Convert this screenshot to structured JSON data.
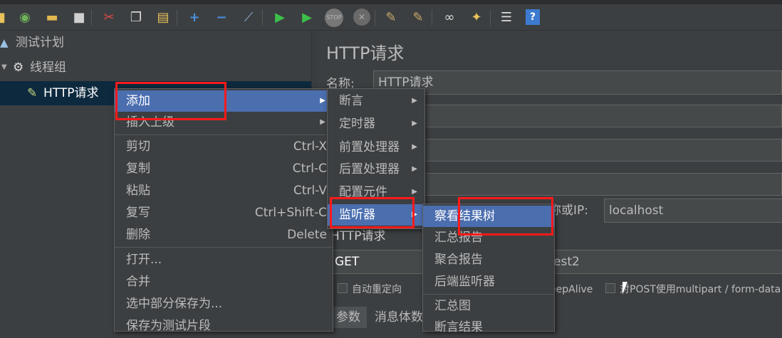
{
  "toolbar": {
    "icons": [
      "new-icon",
      "templates-icon",
      "open-icon",
      "save-icon",
      "cut-icon",
      "copy-icon",
      "paste-icon",
      "expand-icon",
      "collapse-icon",
      "toggle-icon",
      "start-icon",
      "start-no-pause-icon",
      "stop-icon",
      "shutdown-icon",
      "clear-icon",
      "clear-all-icon",
      "search-icon",
      "reset-search-icon",
      "function-helper-icon",
      "help-icon"
    ]
  },
  "tree": {
    "items": [
      {
        "label": "测试计划",
        "icon": "flask-icon"
      },
      {
        "label": "线程组",
        "icon": "gear-icon"
      },
      {
        "label": "HTTP请求",
        "icon": "pipette-icon"
      }
    ]
  },
  "panel": {
    "title": "HTTP请求",
    "name_label": "名称:",
    "name_value": "HTTP请求",
    "server_label": "称或IP:",
    "server_value": "localhost",
    "request_label": "HTTP请求",
    "method_value": "GET",
    "path_fragment": "est2",
    "checkbox_redirect": "自动重定向",
    "checkbox_keepalive": "eepAlive",
    "checkbox_multipart": "对POST使用multipart / form-data",
    "tab_params": "参数",
    "tab_body": "消息体数"
  },
  "menu_main": {
    "items": [
      {
        "label": "添加",
        "shortcut": "",
        "submenu": true
      },
      {
        "label": "插入上级",
        "shortcut": "",
        "submenu": true
      },
      {
        "label": "剪切",
        "shortcut": "Ctrl-X"
      },
      {
        "label": "复制",
        "shortcut": "Ctrl-C"
      },
      {
        "label": "粘贴",
        "shortcut": "Ctrl-V"
      },
      {
        "label": "复写",
        "shortcut": "Ctrl+Shift-C"
      },
      {
        "label": "删除",
        "shortcut": "Delete"
      },
      {
        "label": "打开..."
      },
      {
        "label": "合并"
      },
      {
        "label": "选中部分保存为..."
      },
      {
        "label": "保存为测试片段"
      }
    ]
  },
  "menu_add": {
    "items": [
      "断言",
      "定时器",
      "前置处理器",
      "后置处理器",
      "配置元件",
      "监听器"
    ]
  },
  "menu_listener": {
    "items": [
      "察看结果树",
      "汇总报告",
      "聚合报告",
      "后端监听器",
      "汇总图",
      "断言结果"
    ]
  },
  "colors": {
    "highlight": "#4b6eaf",
    "annotation": "#ff1a1a"
  }
}
